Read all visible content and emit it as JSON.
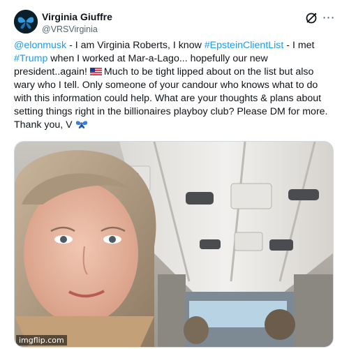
{
  "author": {
    "name": "Virginia Giuffre",
    "handle": "@VRSVirginia",
    "avatar_icon": "butterfly-avatar-icon"
  },
  "tweet": {
    "mention": "@elonmusk",
    "text_1": " - I am Virginia Roberts, I know ",
    "hashtag_1": "#EpsteinClientList",
    "text_2": " - I met ",
    "hashtag_2": "#Trump",
    "text_3": " when I worked at Mar-a-Lago... hopefully our new president..again! ",
    "text_4": "Much to be tight lipped about on the list but also wary who I tell. Only someone of your candour who knows what to do with this information could help. What are your thoughts & plans about setting things right in the billionaires playboy club? Please DM for more. Thank you, V ",
    "flag_icon": "us-flag-icon",
    "emoji_icon": "butterfly-emoji-icon"
  },
  "media": {
    "description_icon": "selfie-photo-image"
  },
  "watermark": "imgflip.com",
  "colors": {
    "link": "#1d9bf0",
    "text": "#0f1419",
    "secondary": "#536471"
  }
}
